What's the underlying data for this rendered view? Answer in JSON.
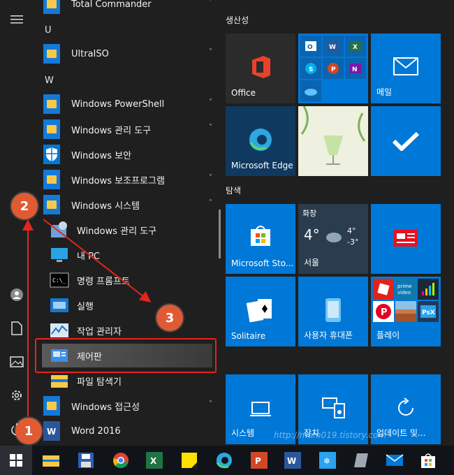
{
  "app_list": {
    "sections": [
      "U",
      "W"
    ],
    "top_app": "Total Commander",
    "apps": [
      {
        "label": "UltraISO",
        "chevron": "˅"
      },
      {
        "label": "Windows PowerShell",
        "chevron": "˅"
      },
      {
        "label": "Windows 관리 도구",
        "chevron": "˅"
      },
      {
        "label": "Windows 보안",
        "chevron": ""
      },
      {
        "label": "Windows 보조프로그램",
        "chevron": "˅"
      },
      {
        "label": "Windows 시스템",
        "chevron": "˄"
      }
    ],
    "system_items": [
      "Windows 관리 도구",
      "내 PC",
      "명령 프롬프트",
      "실행",
      "작업 관리자",
      "제어판",
      "파일 탐색기"
    ],
    "after_apps": [
      {
        "label": "Windows 접근성",
        "chevron": "˅"
      },
      {
        "label": "Word 2016",
        "chevron": ""
      }
    ]
  },
  "tiles": {
    "group1": "생산성",
    "group2": "탐색",
    "office": "Office",
    "mail": "메일",
    "edge": "Microsoft Edge",
    "store": "Microsoft Sto...",
    "weather": {
      "label": "화창",
      "temp": "4°",
      "hi": "4°",
      "lo": "-3°",
      "city": "서울"
    },
    "solitaire": "Solitaire",
    "phone": "사용자 휴대폰",
    "play": "플레이",
    "system": "시스템",
    "device": "장치",
    "update": "업데이트 및..."
  },
  "annotations": {
    "b1": "1",
    "b2": "2",
    "b3": "3"
  },
  "watermark": "http://mom019.tistory.com",
  "colors": {
    "accent": "#0078d7",
    "badge": "#e05a33",
    "box": "#e5241d"
  }
}
